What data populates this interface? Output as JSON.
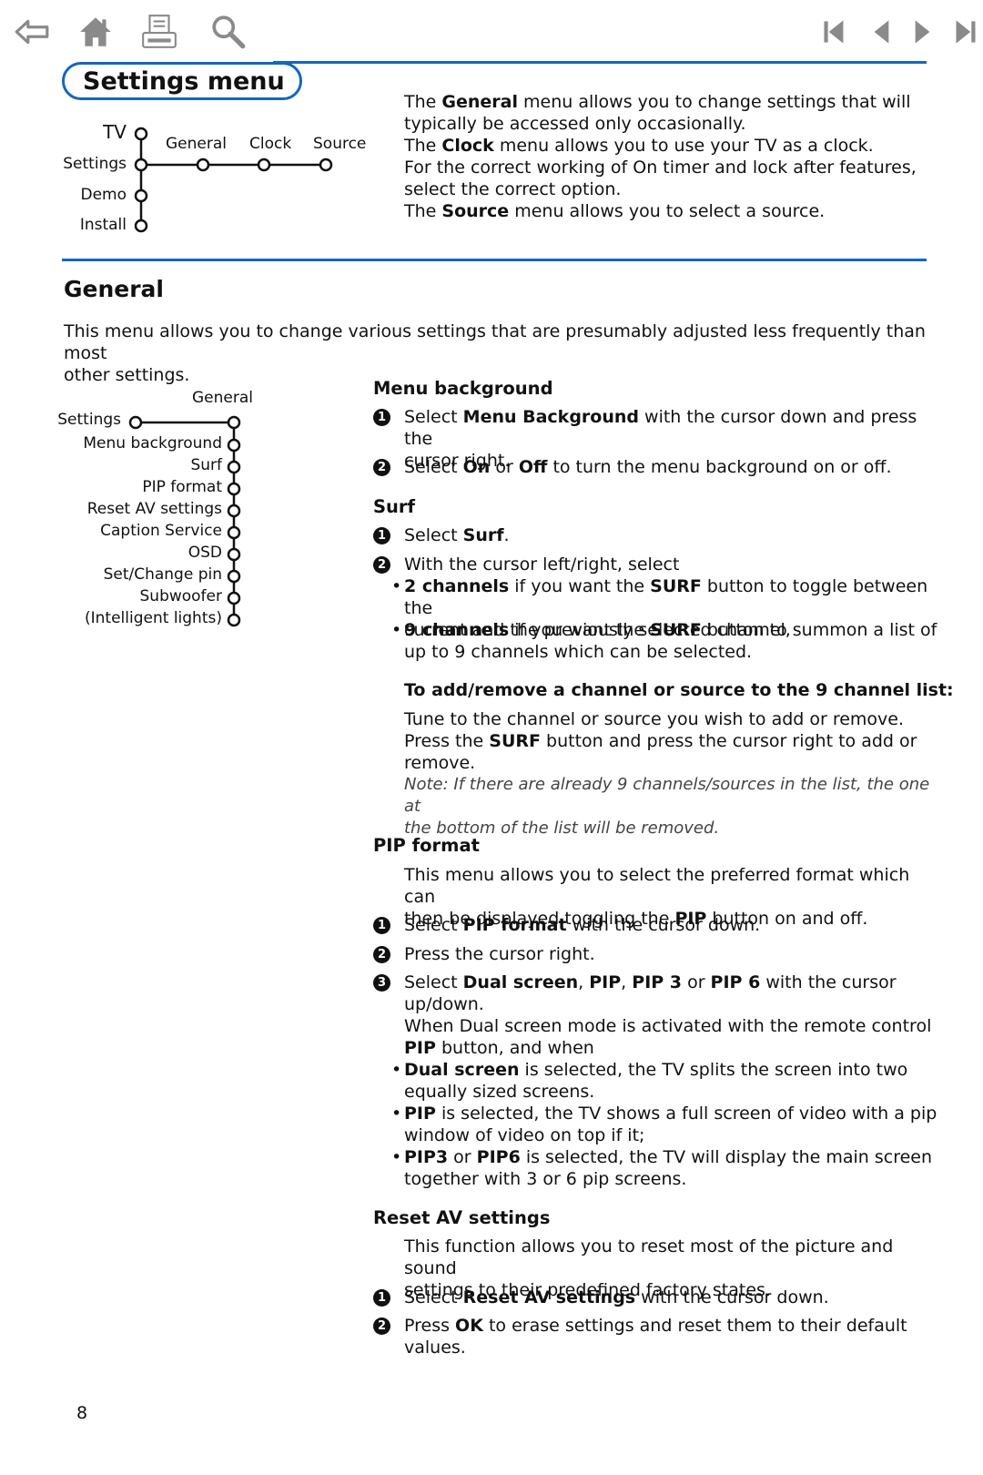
{
  "toolbar": {
    "left": [
      {
        "name": "back-arrow-icon"
      },
      {
        "name": "home-icon"
      },
      {
        "name": "print-icon"
      },
      {
        "name": "search-icon"
      }
    ],
    "right": [
      {
        "name": "first-page-icon"
      },
      {
        "name": "previous-page-icon"
      },
      {
        "name": "next-page-icon"
      },
      {
        "name": "last-page-icon"
      }
    ],
    "accent_color": "#1466c2",
    "icon_color": "#8a8a8a"
  },
  "settings_menu": {
    "title": "Settings menu",
    "diagram": {
      "vertical": [
        "TV",
        "Settings",
        "Demo",
        "Install"
      ],
      "horizontal": [
        "General",
        "Clock",
        "Source"
      ]
    },
    "description": {
      "l1a": "The ",
      "l1b": "General",
      "l1c": " menu allows you to change settings that will",
      "l2": "typically be accessed only occasionally.",
      "l3a": "The ",
      "l3b": "Clock",
      "l3c": " menu allows you to use your TV as a clock.",
      "l4": "For the correct working of On timer and lock after features,",
      "l5": "select the correct option.",
      "l6a": "The ",
      "l6b": "Source",
      "l6c": " menu allows you to select a source."
    }
  },
  "general": {
    "heading": "General",
    "intro_1": "This menu allows you to change various settings that are presumably adjusted less frequently than most",
    "intro_2": "other settings.",
    "diagram": {
      "top_label": "General",
      "root": "Settings",
      "items": [
        "Menu background",
        "Surf",
        "PIP format",
        "Reset AV settings",
        "Caption Service",
        "OSD",
        "Set/Change pin",
        "Subwoofer",
        "(Intelligent lights)"
      ]
    }
  },
  "menu_background": {
    "heading": "Menu background",
    "s1": {
      "n": "1",
      "a": "Select ",
      "b": "Menu Background",
      "c": " with the cursor down and press the",
      "d": "cursor right."
    },
    "s2": {
      "n": "2",
      "a": "Select ",
      "b": "On",
      "c": " or ",
      "d": "Off",
      "e": " to turn the menu background on or off."
    }
  },
  "surf": {
    "heading": "Surf",
    "s1": {
      "n": "1",
      "a": "Select ",
      "b": "Surf",
      "c": "."
    },
    "s2": {
      "n": "2",
      "a": "With the cursor left/right, select"
    },
    "b1": {
      "a": "2 channels",
      "b": " if you want the ",
      "c": "SURF",
      "d": " button to toggle between the",
      "e": "current and the previously selected channel,"
    },
    "b2": {
      "a": "9 channels",
      "b": " if you want the ",
      "c": "SURF",
      "d": " button to summon a list of",
      "e": "up to 9 channels which can be selected."
    },
    "sub_heading": "To add/remove a channel or source to the 9 channel list:",
    "t1": "Tune to the channel or source you wish to add or remove.",
    "t2a": "Press the ",
    "t2b": "SURF",
    "t2c": " button and press the cursor right to add or",
    "t3": "remove.",
    "note1": "Note: If there are already 9 channels/sources in the list, the one at",
    "note2": "the bottom of the list will be removed."
  },
  "pip_format": {
    "heading": "PIP format",
    "i1": "This menu allows you to select the preferred format which can",
    "i2a": "then be displayed toggling the ",
    "i2b": "PIP",
    "i2c": " button on and off.",
    "s1": {
      "n": "1",
      "a": "Select ",
      "b": "PIP format",
      "c": " with the cursor down."
    },
    "s2": {
      "n": "2",
      "a": "Press the cursor right."
    },
    "s3": {
      "n": "3",
      "a": "Select ",
      "b": "Dual screen",
      "c": ", ",
      "d": "PIP",
      "e": ", ",
      "f": "PIP 3",
      "g": " or ",
      "h": "PIP 6",
      "i": " with the cursor",
      "j": "up/down."
    },
    "w1": "When Dual screen mode is activated with the remote control",
    "w2a": "PIP",
    "w2b": " button, and when",
    "b1": {
      "a": "Dual screen",
      "b": " is selected, the TV splits the screen into two",
      "c": "equally sized screens."
    },
    "b2": {
      "a": "PIP",
      "b": " is selected, the TV shows a full screen of video with a pip",
      "c": "window of video on top if it;"
    },
    "b3": {
      "a": "PIP3",
      "b": " or ",
      "c": "PIP6",
      "d": " is selected, the TV will display the main screen",
      "e": "together with 3 or 6 pip screens."
    }
  },
  "reset_av": {
    "heading": "Reset AV settings",
    "i1": "This function allows you to reset most of the picture and sound",
    "i2": "settings to their predefined factory states.",
    "s1": {
      "n": "1",
      "a": "Select ",
      "b": "Reset AV settings",
      "c": " with the cursor down."
    },
    "s2": {
      "n": "2",
      "a": "Press ",
      "b": "OK",
      "c": " to erase settings and reset them to their default",
      "d": "values."
    }
  },
  "footer": {
    "page_number": "8"
  }
}
